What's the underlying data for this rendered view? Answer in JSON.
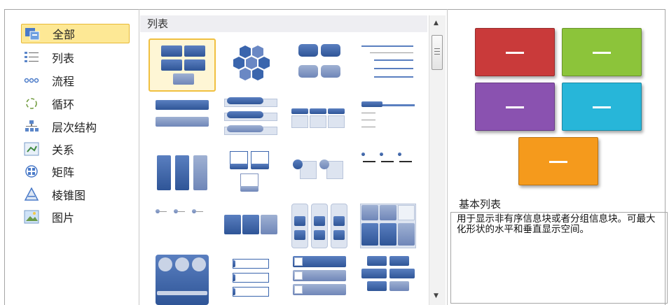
{
  "categories": [
    {
      "label": "全部",
      "icon": "all-layouts-icon",
      "selected": true
    },
    {
      "label": "列表",
      "icon": "list-icon",
      "selected": false
    },
    {
      "label": "流程",
      "icon": "process-icon",
      "selected": false
    },
    {
      "label": "循环",
      "icon": "cycle-icon",
      "selected": false
    },
    {
      "label": "层次结构",
      "icon": "hierarchy-icon",
      "selected": false
    },
    {
      "label": "关系",
      "icon": "relationship-icon",
      "selected": false
    },
    {
      "label": "矩阵",
      "icon": "matrix-icon",
      "selected": false
    },
    {
      "label": "棱锥图",
      "icon": "pyramid-icon",
      "selected": false
    },
    {
      "label": "图片",
      "icon": "picture-icon",
      "selected": false
    }
  ],
  "gallery": {
    "header": "列表",
    "selected_index": 0
  },
  "preview": {
    "title": "基本列表",
    "description": "用于显示非有序信息块或者分组信息块。可最大化形状的水平和垂直显示空间。",
    "colors": [
      "#c93a3a",
      "#8cc43a",
      "#8a52b0",
      "#27b6d9",
      "#f59a1c"
    ]
  }
}
